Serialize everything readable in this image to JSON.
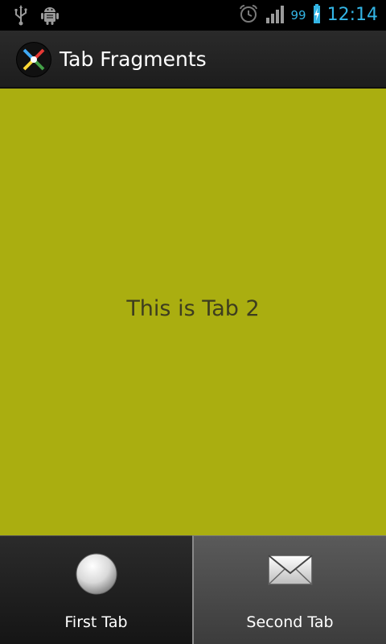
{
  "status_bar": {
    "time": "12:14",
    "battery_level": "99",
    "icons": [
      "usb-icon",
      "android-debug-icon",
      "alarm-icon",
      "signal-icon",
      "battery-charging-icon"
    ]
  },
  "action_bar": {
    "title": "Tab Fragments",
    "app_icon": "app-logo-icon"
  },
  "content": {
    "text": "This is Tab 2",
    "background_color": "#aaae10"
  },
  "tabs": [
    {
      "label": "First Tab",
      "icon": "circle-icon",
      "selected": false
    },
    {
      "label": "Second Tab",
      "icon": "envelope-icon",
      "selected": true
    }
  ]
}
